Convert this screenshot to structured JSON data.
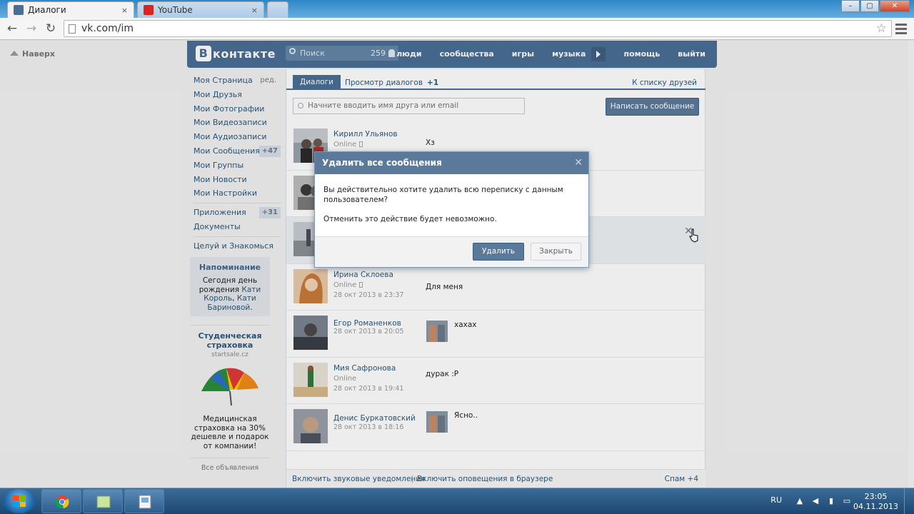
{
  "browser": {
    "tabs": [
      {
        "label": "Диалоги",
        "active": true
      },
      {
        "label": "YouTube",
        "active": false
      }
    ],
    "tab_close": "×",
    "url": "vk.com/im",
    "window_controls": [
      "–",
      "▢",
      "✕"
    ]
  },
  "page": {
    "back_to_top": "Наверх",
    "header": {
      "logo_letter": "В",
      "logo_text": "контакте",
      "search_placeholder": "Поиск",
      "search_count": "259",
      "nav": [
        "люди",
        "сообщества",
        "игры",
        "музыка",
        "помощь",
        "выйти"
      ]
    },
    "left_menu": {
      "items": [
        {
          "label": "Моя Страница",
          "extra": "ред."
        },
        {
          "label": "Мои Друзья"
        },
        {
          "label": "Мои Фотографии"
        },
        {
          "label": "Мои Видеозаписи"
        },
        {
          "label": "Мои Аудиозаписи"
        },
        {
          "label": "Мои Сообщения",
          "count": "+47"
        },
        {
          "label": "Мои Группы"
        },
        {
          "label": "Мои Новости"
        },
        {
          "label": "Мои Настройки"
        }
      ],
      "items2": [
        {
          "label": "Приложения",
          "count": "+31"
        },
        {
          "label": "Документы"
        }
      ],
      "items3": [
        {
          "label": "Целуй и Знакомься"
        }
      ]
    },
    "reminder": {
      "title": "Напоминание",
      "text_pre": "Сегодня день рождения ",
      "link1": "Кати Король",
      "text_mid": ", ",
      "link2": "Кати Бариновой",
      "text_post": "."
    },
    "ad": {
      "title": "Студенческая страховка",
      "domain": "startsale.cz",
      "text": "Медицинская страховка на 30% дешевле и подарок от компании!",
      "all_ads": "Все объявления"
    },
    "main": {
      "tab_active": "Диалоги",
      "tab_view": "Просмотр диалогов",
      "tab_view_count": "+1",
      "friends_link": "К списку друзей",
      "search_placeholder": "Начните вводить имя друга или email",
      "write_button": "Написать сообщение",
      "dialogs": [
        {
          "name": "Кирилл Ульянов",
          "status": "Online",
          "date": "",
          "message": "Хз"
        },
        {
          "name": "",
          "status": "",
          "date": "",
          "message": ""
        },
        {
          "name": "",
          "status": "",
          "date": "",
          "message": ""
        },
        {
          "name": "Ирина Склоева",
          "status": "Online",
          "date": "28 окт 2013 в 23:37",
          "message": "Для меня"
        },
        {
          "name": "Егор Романенков",
          "status": "",
          "date": "28 окт 2013 в 20:05",
          "message": "хахах"
        },
        {
          "name": "Мия Сафронова",
          "status": "Online",
          "date": "28 окт 2013 в 19:41",
          "message": "дурак :Р"
        },
        {
          "name": "Денис Буркатовский",
          "status": "",
          "date": "28 окт 2013 в 18:16",
          "message": "Ясно.."
        }
      ],
      "delete_x": "✕",
      "bottom": {
        "sound": "Включить звуковые уведомления",
        "separator": "|",
        "browser": "Включить оповещения в браузере",
        "spam": "Спам +4"
      }
    },
    "dialog": {
      "title": "Удалить все сообщения",
      "close": "✕",
      "question": "Вы действительно хотите удалить всю переписку с данным пользователем?",
      "warning": "Отменить это действие будет невозможно.",
      "ok": "Удалить",
      "cancel": "Закрыть"
    }
  },
  "taskbar": {
    "lang": "RU",
    "time": "23:05",
    "date": "04.11.2013"
  },
  "colors": {
    "vk_blue": "#4a6e95",
    "vk_link": "#2b587a",
    "button": "#5b7a9a"
  }
}
